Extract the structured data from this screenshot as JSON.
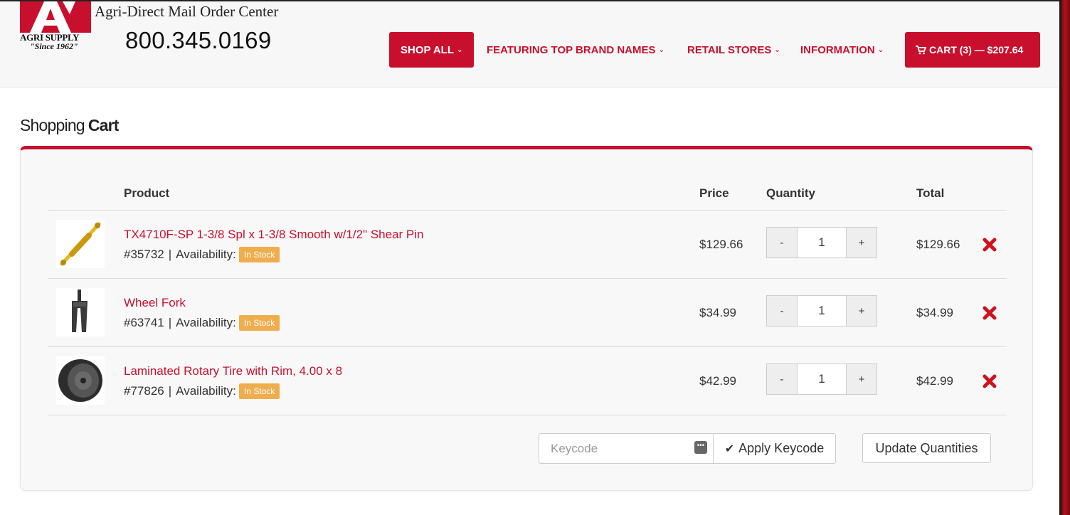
{
  "header": {
    "logo_name": "AGRI SUPPLY",
    "logo_since": "\"Since 1962\"",
    "mail_title": "Agri-Direct Mail Order Center",
    "phone": "800.345.0169"
  },
  "nav": {
    "shop_all": "SHOP ALL",
    "brands": "FEATURING TOP BRAND NAMES",
    "retail": "RETAIL STORES",
    "info": "INFORMATION",
    "cart": "CART (3) — $207.64"
  },
  "page": {
    "title_light": "Shopping",
    "title_bold": "Cart"
  },
  "table": {
    "headers": {
      "product": "Product",
      "price": "Price",
      "quantity": "Quantity",
      "total": "Total"
    },
    "availability_label": "Availability:",
    "rows": [
      {
        "name": "TX4710F-SP 1-3/8 Spl x 1-3/8 Smooth w/1/2\" Shear Pin",
        "sku": "#35732",
        "stock": "In Stock",
        "price": "$129.66",
        "qty": "1",
        "total": "$129.66"
      },
      {
        "name": "Wheel Fork",
        "sku": "#63741",
        "stock": "In Stock",
        "price": "$34.99",
        "qty": "1",
        "total": "$34.99"
      },
      {
        "name": "Laminated Rotary Tire with Rim, 4.00 x 8",
        "sku": "#77826",
        "stock": "In Stock",
        "price": "$42.99",
        "qty": "1",
        "total": "$42.99"
      }
    ]
  },
  "actions": {
    "keycode_placeholder": "Keycode",
    "apply": "Apply Keycode",
    "update": "Update Quantities",
    "minus": "-",
    "plus": "+",
    "separator": "|"
  },
  "colors": {
    "brand_red": "#c8102e",
    "badge_orange": "#f0ad4e"
  }
}
